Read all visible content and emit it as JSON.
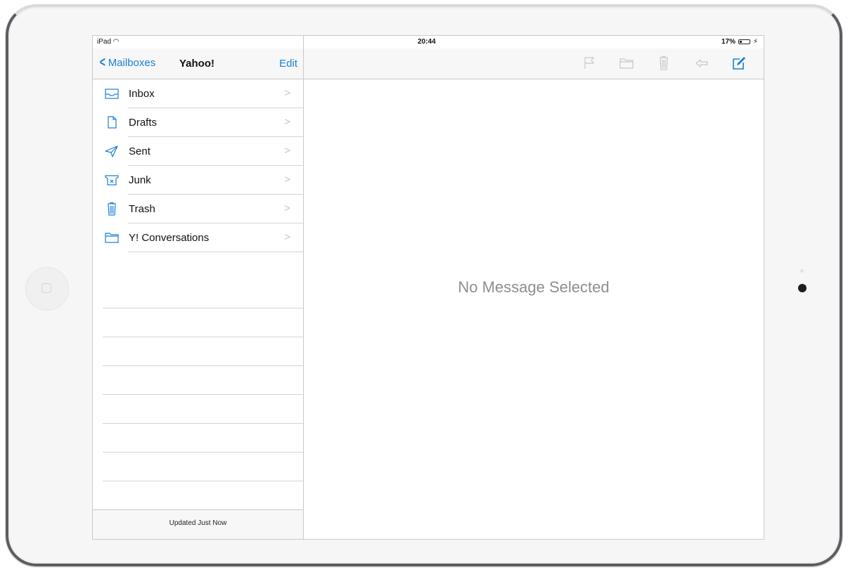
{
  "status_bar": {
    "device": "iPad",
    "time": "20:44",
    "battery": "17%"
  },
  "left_header": {
    "back_label": "Mailboxes",
    "title": "Yahoo!",
    "edit_label": "Edit"
  },
  "mailboxes": [
    {
      "label": "Inbox",
      "icon": "inbox-icon"
    },
    {
      "label": "Drafts",
      "icon": "drafts-icon"
    },
    {
      "label": "Sent",
      "icon": "sent-icon"
    },
    {
      "label": "Junk",
      "icon": "junk-icon"
    },
    {
      "label": "Trash",
      "icon": "trash-icon"
    },
    {
      "label": "Y! Conversations",
      "icon": "folder-icon"
    }
  ],
  "footer": {
    "status": "Updated Just Now"
  },
  "toolbar": {
    "icons": [
      "flag-icon",
      "folder-icon",
      "trash-icon",
      "reply-icon",
      "compose-icon"
    ]
  },
  "detail": {
    "empty_text": "No Message Selected"
  },
  "colors": {
    "accent": "#1a7fd6",
    "disabled_icon": "#c7c7cc",
    "placeholder_text": "#8e8e93"
  }
}
